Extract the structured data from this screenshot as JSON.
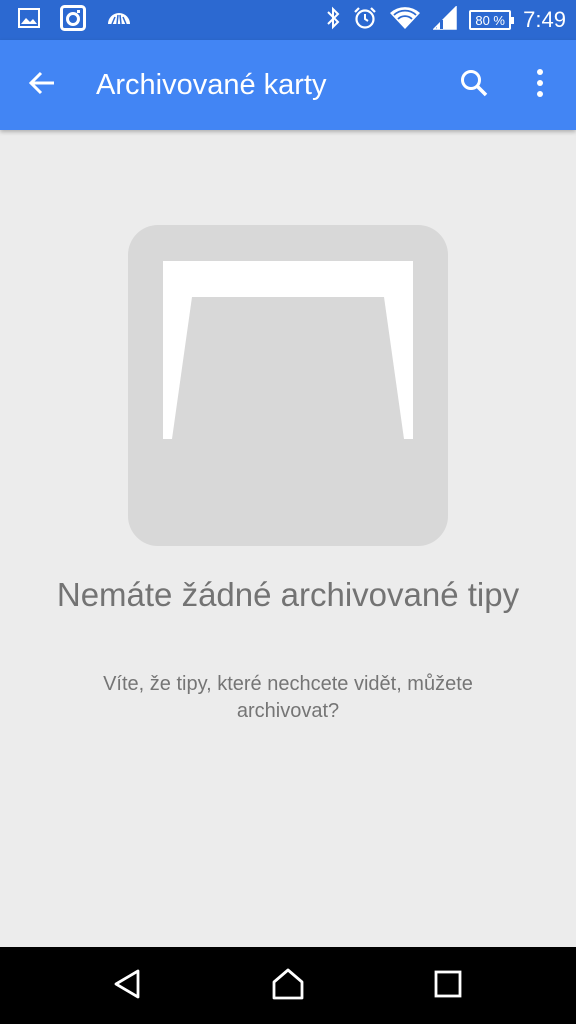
{
  "status_bar": {
    "battery_text": "80 %",
    "time": "7:49",
    "left_icons": [
      "image-notification-icon",
      "instagram-icon",
      "cloud-upload-icon"
    ],
    "right_icons": [
      "bluetooth-icon",
      "alarm-icon",
      "wifi-icon",
      "signal-icon",
      "battery-icon"
    ]
  },
  "app_bar": {
    "title": "Archivované karty",
    "back_icon": "arrow-back-icon",
    "search_icon": "search-icon",
    "more_icon": "more-vert-icon"
  },
  "empty_state": {
    "illustration": "archive-tray-icon",
    "title": "Nemáte žádné archivované tipy",
    "subtitle": "Víte, že tipy, které nechcete vidět, můžete archivovat?"
  },
  "nav_bar": {
    "back_icon": "nav-back-icon",
    "home_icon": "nav-home-icon",
    "recents_icon": "nav-recents-icon"
  },
  "colors": {
    "status_bar": "#2c69d1",
    "app_bar": "#4285f4",
    "background": "#ececec",
    "illustration": "#d8d8d8",
    "text_primary": "#737373",
    "text_secondary": "#757575"
  }
}
